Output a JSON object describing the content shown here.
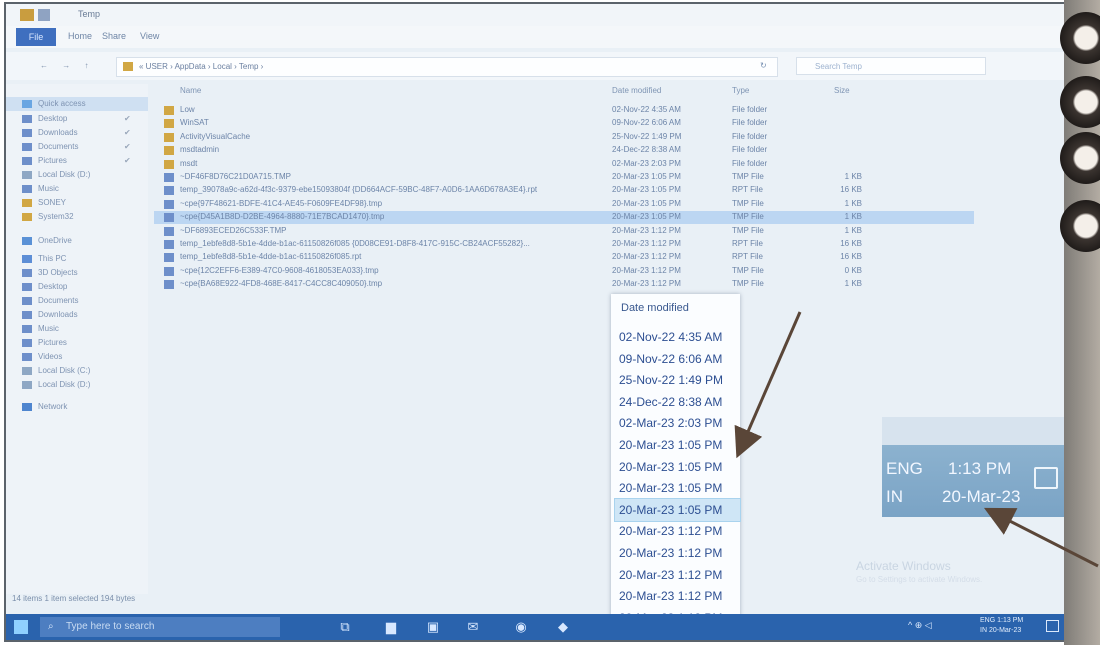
{
  "window": {
    "title": "Temp",
    "tabs": [
      "File",
      "Home",
      "Share",
      "View"
    ]
  },
  "address": {
    "nav_glyphs": "← → ↑",
    "path": "« USER › AppData › Local › Temp ›",
    "refresh_glyph": "↻",
    "search_placeholder": "Search Temp"
  },
  "nav_pane": {
    "items": [
      {
        "label": "Quick access",
        "icon": "star-icon",
        "selected": true
      },
      {
        "label": "Desktop",
        "icon": "desktop-icon",
        "pinned": true
      },
      {
        "label": "Downloads",
        "icon": "download-icon",
        "pinned": true
      },
      {
        "label": "Documents",
        "icon": "documents-icon",
        "pinned": true
      },
      {
        "label": "Pictures",
        "icon": "pictures-icon",
        "pinned": true
      },
      {
        "label": "Local Disk (D:)",
        "icon": "disk-icon"
      },
      {
        "label": "Music",
        "icon": "music-icon"
      },
      {
        "label": "SONEY",
        "icon": "folder-icon"
      },
      {
        "label": "System32",
        "icon": "folder-icon"
      },
      {
        "label": "OneDrive",
        "icon": "cloud-icon"
      },
      {
        "label": "This PC",
        "icon": "pc-icon"
      },
      {
        "label": "3D Objects",
        "icon": "objects-icon"
      },
      {
        "label": "Desktop",
        "icon": "desktop-icon"
      },
      {
        "label": "Documents",
        "icon": "documents-icon"
      },
      {
        "label": "Downloads",
        "icon": "download-icon"
      },
      {
        "label": "Music",
        "icon": "music-icon"
      },
      {
        "label": "Pictures",
        "icon": "pictures-icon"
      },
      {
        "label": "Videos",
        "icon": "videos-icon"
      },
      {
        "label": "Local Disk (C:)",
        "icon": "disk-icon"
      },
      {
        "label": "Local Disk (D:)",
        "icon": "disk-icon"
      },
      {
        "label": "Network",
        "icon": "network-icon"
      }
    ]
  },
  "columns": {
    "name": "Name",
    "date": "Date modified",
    "type": "Type",
    "size": "Size"
  },
  "files": [
    {
      "name": "Low",
      "date": "02-Nov-22 4:35 AM",
      "type": "File folder",
      "size": "",
      "kind": "folder"
    },
    {
      "name": "WinSAT",
      "date": "09-Nov-22 6:06 AM",
      "type": "File folder",
      "size": "",
      "kind": "folder"
    },
    {
      "name": "ActivityVisualCache",
      "date": "25-Nov-22 1:49 PM",
      "type": "File folder",
      "size": "",
      "kind": "folder"
    },
    {
      "name": "msdtadmin",
      "date": "24-Dec-22 8:38 AM",
      "type": "File folder",
      "size": "",
      "kind": "folder"
    },
    {
      "name": "msdt",
      "date": "02-Mar-23 2:03 PM",
      "type": "File folder",
      "size": "",
      "kind": "folder"
    },
    {
      "name": "~DF46F8D76C21D0A715.TMP",
      "date": "20-Mar-23 1:05 PM",
      "type": "TMP File",
      "size": "1 KB",
      "kind": "file"
    },
    {
      "name": "temp_39078a9c-a62d-4f3c-9379-ebe15093804f {DD664ACF-59BC-48F7-A0D6-1AA6D678A3E4}.rpt",
      "date": "20-Mar-23 1:05 PM",
      "type": "RPT File",
      "size": "16 KB",
      "kind": "file"
    },
    {
      "name": "~cpe{97F48621-BDFE-41C4-AE45-F0609FE4DF98}.tmp",
      "date": "20-Mar-23 1:05 PM",
      "type": "TMP File",
      "size": "1 KB",
      "kind": "file"
    },
    {
      "name": "~cpe{D45A1B8D-D2BE-4964-8880-71E7BCAD1470}.tmp",
      "date": "20-Mar-23 1:05 PM",
      "type": "TMP File",
      "size": "1 KB",
      "kind": "file",
      "selected": true
    },
    {
      "name": "~DF6893ECED26C533F.TMP",
      "date": "20-Mar-23 1:12 PM",
      "type": "TMP File",
      "size": "1 KB",
      "kind": "file"
    },
    {
      "name": "temp_1ebfe8d8-5b1e-4dde-b1ac-61150826f085 {0D08CE91-D8F8-417C-915C-CB24ACF55282}...",
      "date": "20-Mar-23 1:12 PM",
      "type": "RPT File",
      "size": "16 KB",
      "kind": "file"
    },
    {
      "name": "temp_1ebfe8d8-5b1e-4dde-b1ac-61150826f085.rpt",
      "date": "20-Mar-23 1:12 PM",
      "type": "RPT File",
      "size": "16 KB",
      "kind": "file"
    },
    {
      "name": "~cpe{12C2EFF6-E389-47C0-9608-4618053EA033}.tmp",
      "date": "20-Mar-23 1:12 PM",
      "type": "TMP File",
      "size": "0 KB",
      "kind": "file"
    },
    {
      "name": "~cpe{BA68E922-4FD8-468E-8417-C4CC8C409050}.tmp",
      "date": "20-Mar-23 1:12 PM",
      "type": "TMP File",
      "size": "1 KB",
      "kind": "file"
    }
  ],
  "status_bar": "14 items   1 item selected  194 bytes",
  "zoom_dates": {
    "header": "Date modified",
    "items": [
      "02-Nov-22 4:35 AM",
      "09-Nov-22 6:06 AM",
      "25-Nov-22 1:49 PM",
      "24-Dec-22 8:38 AM",
      "02-Mar-23 2:03 PM",
      "20-Mar-23 1:05 PM",
      "20-Mar-23 1:05 PM",
      "20-Mar-23 1:05 PM",
      "20-Mar-23 1:05 PM",
      "20-Mar-23 1:12 PM",
      "20-Mar-23 1:12 PM",
      "20-Mar-23 1:12 PM",
      "20-Mar-23 1:12 PM",
      "20-Mar-23 1:12 PM"
    ],
    "highlighted_index": 8
  },
  "zoom_clock": {
    "lang": "ENG",
    "region": "IN",
    "time": "1:13 PM",
    "date": "20-Mar-23"
  },
  "watermark": {
    "title": "Activate Windows",
    "subtitle": "Go to Settings to activate Windows."
  },
  "taskbar": {
    "search_placeholder": "Type here to search",
    "search_glyph": "⌕",
    "tray_glyphs": "^ ⊕ ◁",
    "clock_lang": "ENG",
    "clock_region": "IN",
    "clock_time": "1:13 PM",
    "clock_date": "20-Mar-23",
    "icons": [
      {
        "name": "task-view-icon",
        "glyph": "⧉"
      },
      {
        "name": "file-explorer-icon",
        "glyph": "▆"
      },
      {
        "name": "store-icon",
        "glyph": "▣"
      },
      {
        "name": "mail-icon",
        "glyph": "✉"
      },
      {
        "name": "edge-icon",
        "glyph": "◉"
      },
      {
        "name": "app-icon",
        "glyph": "◆"
      }
    ]
  },
  "colors": {
    "folder": "#d1a744",
    "file": "#6e8fca",
    "annotation_arrow": "#5a4638",
    "accent": "#2a63ad"
  }
}
